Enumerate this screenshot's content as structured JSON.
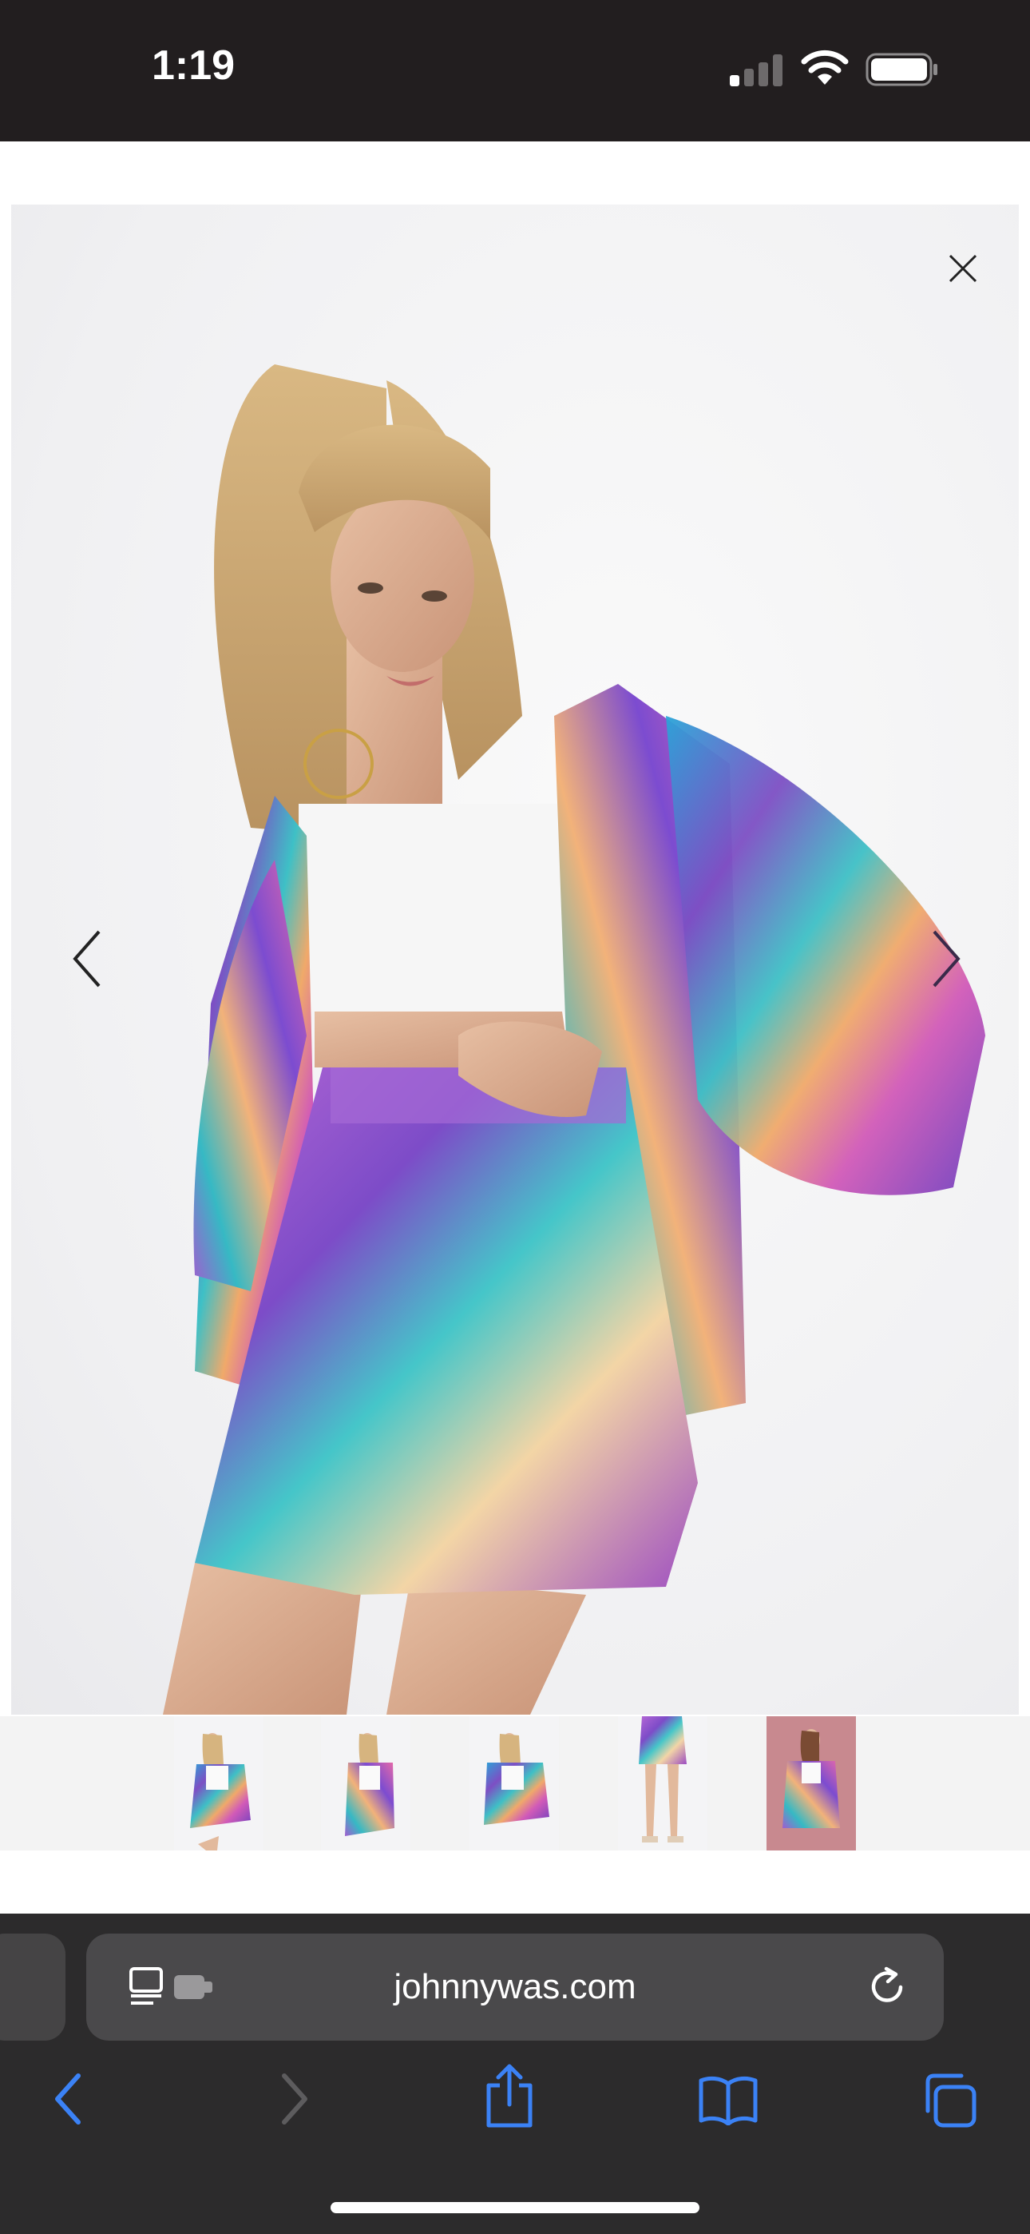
{
  "status_bar": {
    "time": "1:19"
  },
  "product_viewer": {
    "thumbnails": [
      {
        "icon": "model-front-thumbnail"
      },
      {
        "icon": "model-side-thumbnail"
      },
      {
        "icon": "model-three-quarter-thumbnail"
      },
      {
        "icon": "shorts-detail-thumbnail"
      },
      {
        "icon": "model-pink-background-thumbnail"
      }
    ]
  },
  "browser": {
    "url": "johnnywas.com"
  },
  "colors": {
    "status_bg": "#221e1f",
    "chrome_bg": "#2c2b2c",
    "accent": "#3b82f6"
  }
}
